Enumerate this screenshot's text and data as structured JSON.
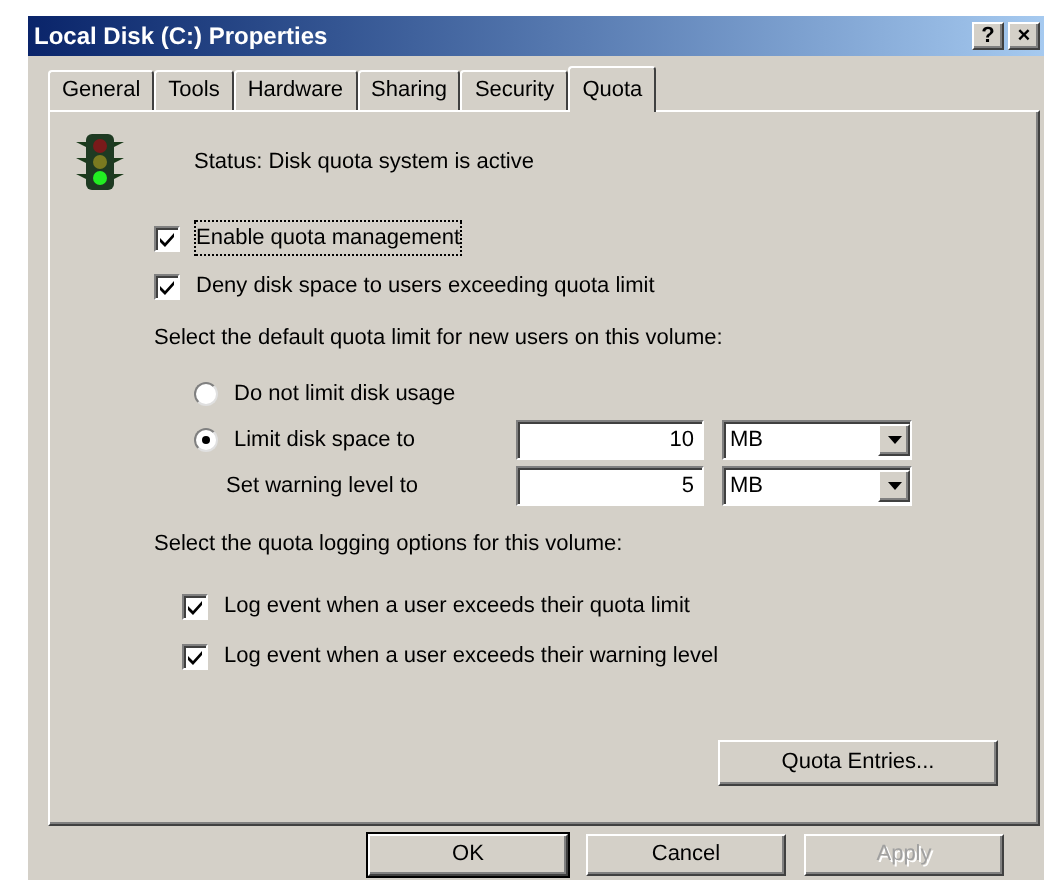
{
  "window": {
    "title": "Local Disk (C:) Properties",
    "title_buttons": [
      "?",
      "×"
    ]
  },
  "tabs": [
    {
      "label": "General",
      "selected": false
    },
    {
      "label": "Tools",
      "selected": false
    },
    {
      "label": "Hardware",
      "selected": false
    },
    {
      "label": "Sharing",
      "selected": false
    },
    {
      "label": "Security",
      "selected": false
    },
    {
      "label": "Quota",
      "selected": true
    }
  ],
  "status": {
    "text": "Status:  Disk quota system is active"
  },
  "options": [
    {
      "label": "Enable quota management",
      "checked": true,
      "focused": true
    },
    {
      "label": "Deny disk space to users exceeding quota limit",
      "checked": true,
      "focused": false
    }
  ],
  "default_limit": {
    "heading": "Select the default quota limit for new users on this volume:",
    "radios": [
      {
        "label": "Do not limit disk usage",
        "selected": false
      },
      {
        "label": "Limit disk space to",
        "selected": true
      }
    ],
    "fields": [
      {
        "value": "10",
        "unit": "MB"
      },
      {
        "label": "Set warning level to",
        "value": "5",
        "unit": "MB"
      }
    ]
  },
  "logging": {
    "heading": "Select the quota logging options for this volume:",
    "options": [
      {
        "label": "Log event when a user exceeds their quota limit",
        "checked": true
      },
      {
        "label": "Log event when a user exceeds their warning level",
        "checked": true
      }
    ]
  },
  "entries_button": "Quota Entries...",
  "buttons": [
    {
      "label": "OK",
      "disabled": false,
      "default": true
    },
    {
      "label": "Cancel",
      "disabled": false,
      "default": false
    },
    {
      "label": "Apply",
      "disabled": true,
      "default": false
    }
  ]
}
